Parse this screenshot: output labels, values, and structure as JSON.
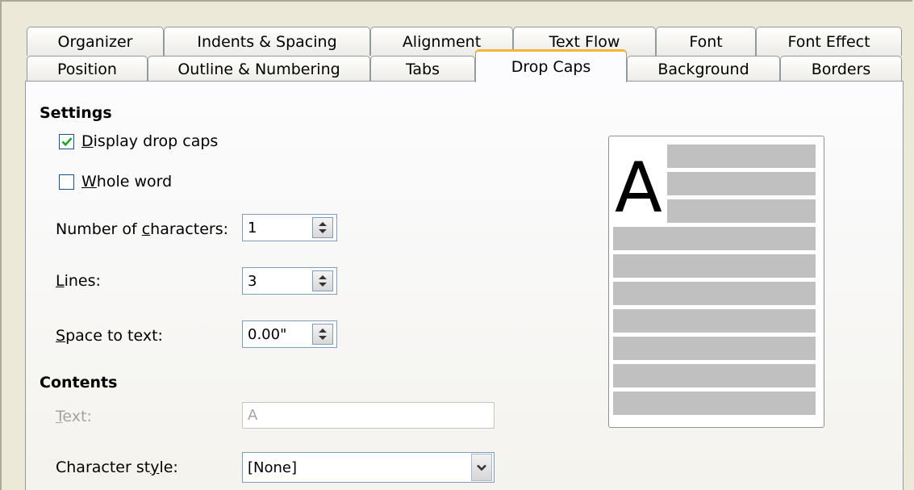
{
  "tabs": {
    "back_row": [
      "Organizer",
      "Indents & Spacing",
      "Alignment",
      "Text Flow",
      "Font",
      "Font Effect"
    ],
    "front_row": [
      "Position",
      "Outline & Numbering",
      "Tabs",
      "Drop Caps",
      "Background",
      "Borders"
    ],
    "active": "Drop Caps"
  },
  "settings": {
    "heading": "Settings",
    "display_drop_caps": {
      "accel": "D",
      "rest": "isplay drop caps",
      "checked": true
    },
    "whole_word": {
      "accel": "W",
      "rest": "hole word",
      "checked": false
    },
    "number_of_characters": {
      "pre": "Number of ",
      "accel": "c",
      "post": "haracters:",
      "value": "1"
    },
    "lines": {
      "accel": "L",
      "rest": "ines:",
      "value": "3"
    },
    "space_to_text": {
      "accel": "S",
      "rest": "pace to text:",
      "value": "0.00\""
    }
  },
  "contents": {
    "heading": "Contents",
    "text": {
      "accel": "T",
      "rest": "ext:",
      "value": "A",
      "disabled": true
    },
    "character_style": {
      "pre": "Character st",
      "accel": "y",
      "post": "le:",
      "value": "[None]"
    }
  },
  "preview": {
    "letter": "A"
  },
  "colors": {
    "active_tab_accent": "#f5b43a",
    "dialog_bg": "#ece9d8",
    "check_mark": "#21a121"
  }
}
